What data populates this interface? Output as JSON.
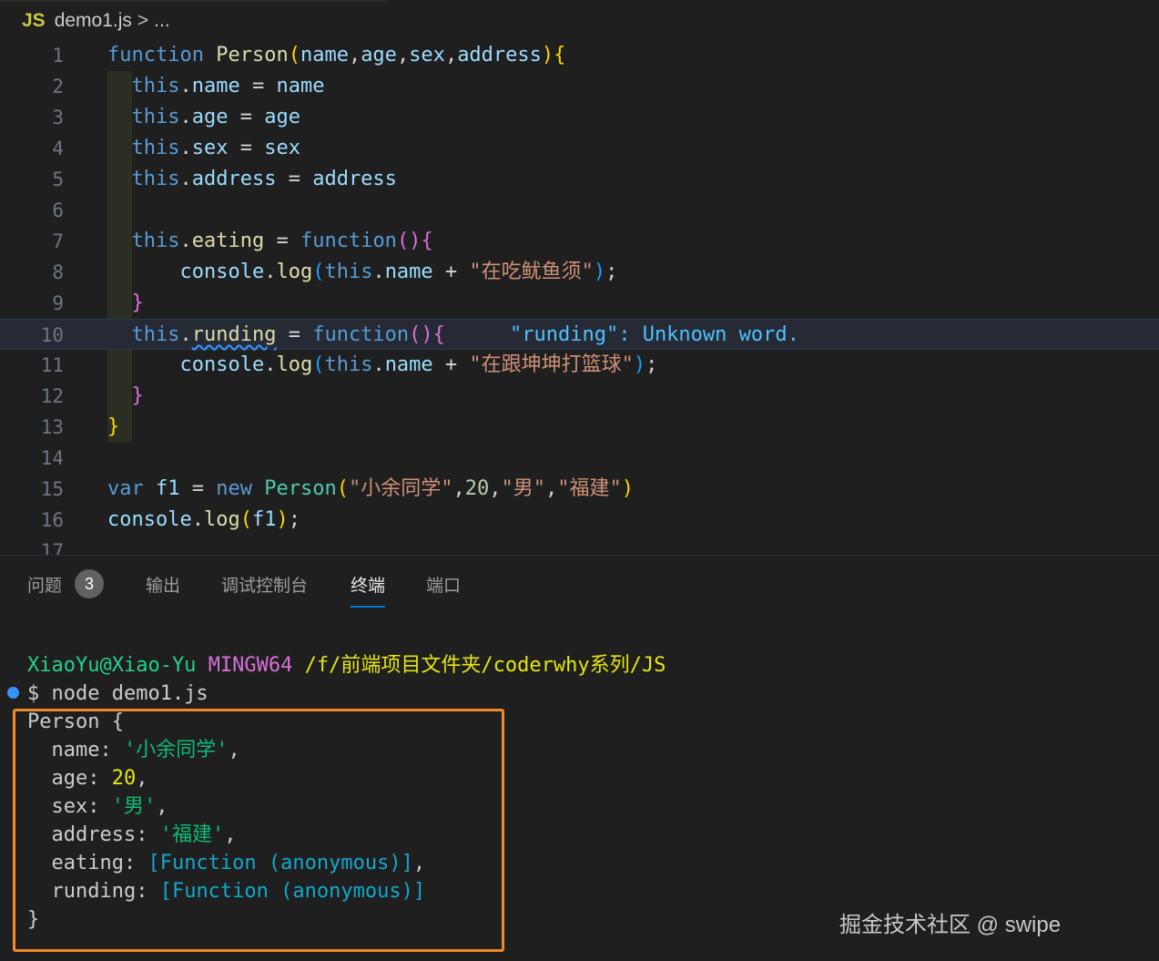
{
  "breadcrumb": {
    "icon": "JS",
    "file": "demo1.js",
    "separator": ">",
    "more": "..."
  },
  "editor": {
    "line_numbers": [
      "1",
      "2",
      "3",
      "4",
      "5",
      "6",
      "7",
      "8",
      "9",
      "10",
      "11",
      "12",
      "13",
      "14",
      "15",
      "16",
      "17"
    ],
    "diagnostic": "\"runding\": Unknown word."
  },
  "panel": {
    "tabs": [
      {
        "label": "问题",
        "badge": "3"
      },
      {
        "label": "输出"
      },
      {
        "label": "调试控制台"
      },
      {
        "label": "终端"
      },
      {
        "label": "端口"
      }
    ]
  },
  "terminal": {
    "user": "XiaoYu@Xiao-Yu",
    "shell": "MINGW64",
    "path": "/f/前端项目文件夹/coderwhy系列/JS",
    "command": "$ node demo1.js",
    "output": {
      "open": "Person {",
      "name_key": "  name: ",
      "name_val": "'小余同学'",
      "age_key": "  age: ",
      "age_val": "20",
      "sex_key": "  sex: ",
      "sex_val": "'男'",
      "address_key": "  address: ",
      "address_val": "'福建'",
      "eating_key": "  eating: ",
      "eating_val": "[Function (anonymous)]",
      "runding_key": "  runding: ",
      "runding_val": "[Function (anonymous)]",
      "close": "}"
    }
  },
  "watermark": "掘金技术社区 @ swipe",
  "colors": {
    "accent": "#0078d4",
    "highlight_box": "#f0882a",
    "background": "#1f1f1f"
  }
}
